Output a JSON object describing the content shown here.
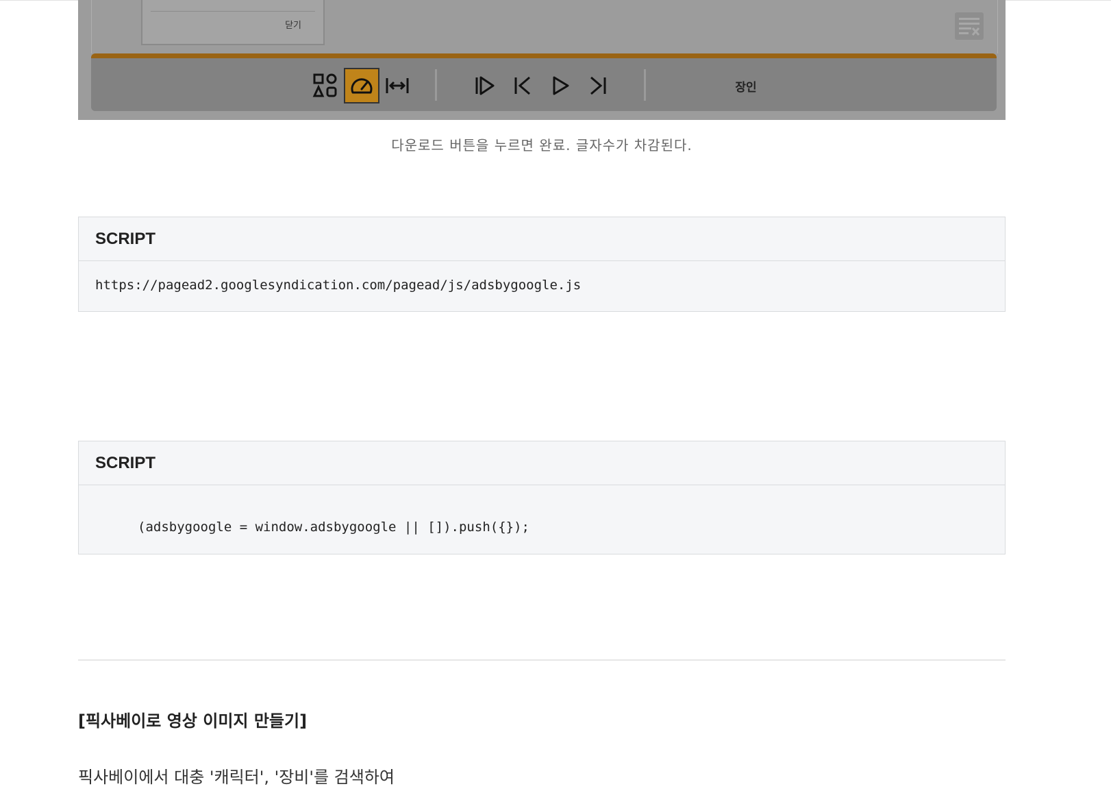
{
  "figure": {
    "dialog": {
      "close_label": "닫기"
    },
    "toolbar": {
      "label": "장인",
      "accent_color": "#c0841a",
      "buttons": [
        {
          "icon": "shapes-icon",
          "active": false
        },
        {
          "icon": "speed-gauge-icon",
          "active": true
        },
        {
          "icon": "fit-width-icon",
          "active": false
        },
        {
          "icon": "play-from-start-icon",
          "active": false
        },
        {
          "icon": "skip-back-icon",
          "active": false
        },
        {
          "icon": "play-icon",
          "active": false
        },
        {
          "icon": "skip-forward-icon",
          "active": false
        }
      ]
    }
  },
  "caption": "다운로드 버튼을 누르면 완료. 글자수가 차감된다.",
  "script_blocks": [
    {
      "title": "SCRIPT",
      "code": "https://pagead2.googlesyndication.com/pagead/js/adsbygoogle.js"
    },
    {
      "title": "SCRIPT",
      "code": "(adsbygoogle = window.adsbygoogle || []).push({});"
    }
  ],
  "section_title": "[픽사베이로 영상 이미지 만들기]",
  "body_text": "픽사베이에서 대충 '캐릭터', '장비'를 검색하여"
}
